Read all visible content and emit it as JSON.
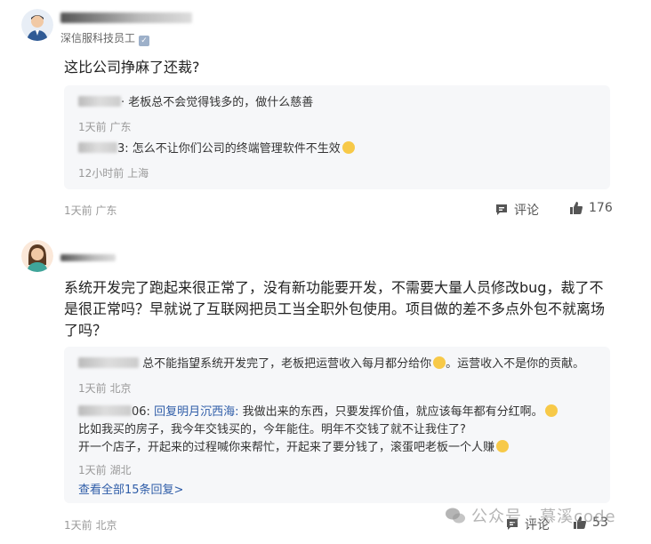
{
  "post1": {
    "author_title": "深信服科技员工",
    "content": "这比公司挣麻了还裁?",
    "replies": [
      {
        "name_tail": "·",
        "text": "老板总不会觉得钱多的，做什么慈善",
        "meta": "1天前 广东"
      },
      {
        "name_tail": "3:",
        "text": "怎么不让你们公司的终端管理软件不生效",
        "meta": "12小时前 上海"
      }
    ],
    "meta": "1天前 广东",
    "comment_label": "评论",
    "like_count": "176"
  },
  "post2": {
    "content": "系统开发完了跑起来很正常了，没有新功能要开发，不需要大量人员修改bug，裁了不是很正常吗？早就说了互联网把员工当全职外包使用。项目做的差不多点外包不就离场了吗？",
    "replies": [
      {
        "text": "总不能指望系统开发完了，老板把运营收入每月都分给你",
        "text_after": "。运营收入不是你的贡献。",
        "meta": "1天前 北京"
      },
      {
        "name_tail": "06:",
        "reply_to": "回复明月沉西海:",
        "line1": "我做出来的东西，只要发挥价值，就应该每年都有分红啊。",
        "line2": "比如我买的房子，我今年交钱买的，今年能住。明年不交钱了就不让我住了?",
        "line3": "开一个店子，开起来的过程喊你来帮忙，开起来了要分钱了，滚蛋吧老板一个人赚",
        "meta": "1天前 湖北"
      }
    ],
    "view_all": "查看全部15条回复>",
    "meta": "1天前 北京",
    "comment_label": "评论",
    "like_count": "53"
  },
  "watermark": "公众号 · 慕溪code",
  "colors": {
    "link": "#2f5da8",
    "reply_bg": "#f6f7f9",
    "meta": "#999999"
  }
}
